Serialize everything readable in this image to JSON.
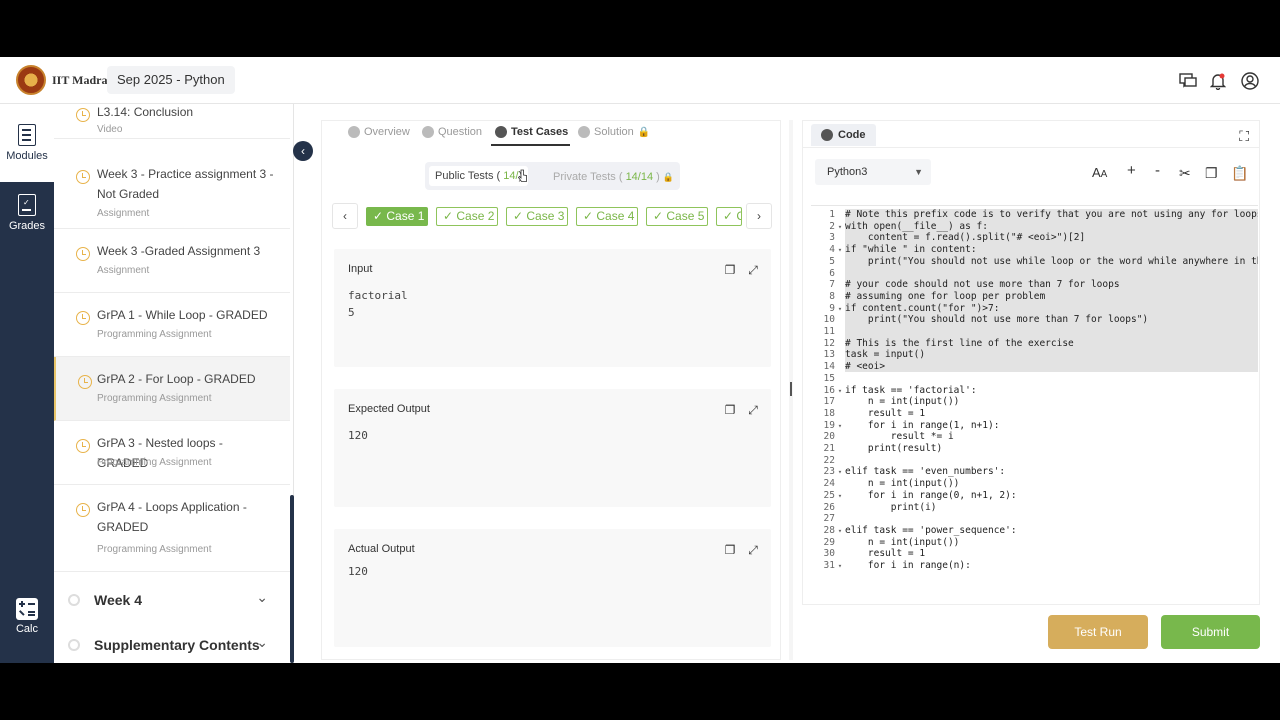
{
  "header": {
    "brand": "IIT Madras",
    "course": "Sep 2025 - Python"
  },
  "rail": {
    "modules": "Modules",
    "grades": "Grades",
    "calc": "Calc"
  },
  "sidebar": {
    "items": [
      {
        "title": "L3.14: Conclusion",
        "sub": "Video"
      },
      {
        "title": "Week 3 - Practice assignment 3 - Not Graded",
        "sub": "Assignment"
      },
      {
        "title": "Week 3 -Graded Assignment 3",
        "sub": "Assignment"
      },
      {
        "title": "GrPA 1 - While Loop - GRADED",
        "sub": "Programming Assignment"
      },
      {
        "title": "GrPA 2 - For Loop - GRADED",
        "sub": "Programming Assignment"
      },
      {
        "title": "GrPA 3 - Nested loops - GRADED",
        "sub": "Programming Assignment"
      },
      {
        "title": "GrPA 4 - Loops Application - GRADED",
        "sub": "Programming Assignment"
      }
    ],
    "week4": "Week 4",
    "supplementary": "Supplementary Contents"
  },
  "tabs": [
    "Overview",
    "Question",
    "Test Cases",
    "Solution"
  ],
  "tests": {
    "public_label": "Public Tests (",
    "public_count": "14/",
    "public_close": ")",
    "private_label": "Private Tests (",
    "private_count": "14/14",
    "private_close": ")"
  },
  "cases": [
    "Case 1",
    "Case 2",
    "Case 3",
    "Case 4",
    "Case 5",
    "C"
  ],
  "io": {
    "input_label": "Input",
    "input_value": "factorial\n5",
    "expected_label": "Expected Output",
    "expected_value": "120",
    "actual_label": "Actual Output",
    "actual_value": "120"
  },
  "code": {
    "tab": "Code",
    "language": "Python3",
    "lines": [
      "# Note this prefix code is to verify that you are not using any for loops i",
      "with open(__file__) as f:",
      "    content = f.read().split(\"# <eoi>\")[2]",
      "if \"while \" in content:",
      "    print(\"You should not use while loop or the word while anywhere in this",
      "",
      "# your code should not use more than 7 for loops",
      "# assuming one for loop per problem",
      "if content.count(\"for \")>7:",
      "    print(\"You should not use more than 7 for loops\")",
      "",
      "# This is the first line of the exercise",
      "task = input()",
      "# <eoi>",
      "",
      "if task == 'factorial':",
      "    n = int(input())",
      "    result = 1",
      "    for i in range(1, n+1):",
      "        result *= i",
      "    print(result)",
      "",
      "elif task == 'even_numbers':",
      "    n = int(input())",
      "    for i in range(0, n+1, 2):",
      "        print(i)",
      "",
      "elif task == 'power_sequence':",
      "    n = int(input())",
      "    result = 1",
      "    for i in range(n):"
    ],
    "folds": [
      2,
      4,
      9,
      16,
      19,
      23,
      25,
      28,
      31
    ]
  },
  "buttons": {
    "test_run": "Test Run",
    "submit": "Submit",
    "test_run_color": "#d6ad5c",
    "submit_color": "#78b84c"
  }
}
